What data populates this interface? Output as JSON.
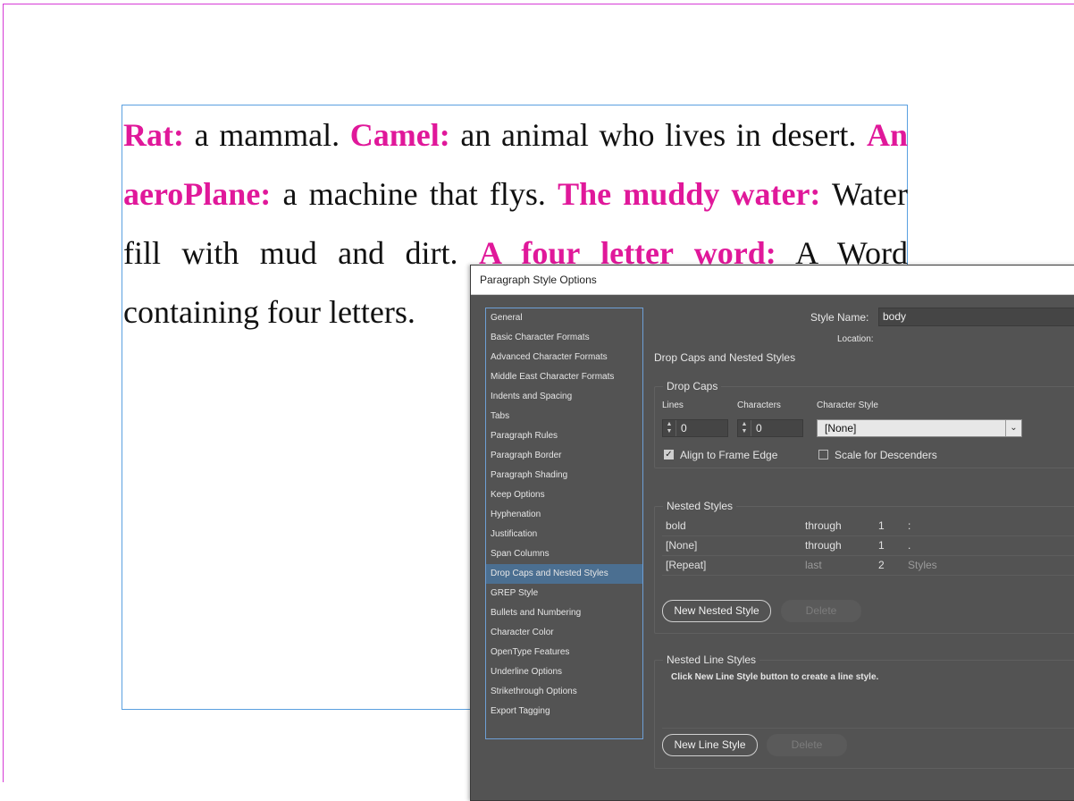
{
  "document": {
    "paragraph": [
      {
        "term": "Rat:",
        "def": " a mammal. "
      },
      {
        "term": "Camel:",
        "def": " an animal who lives in desert. "
      },
      {
        "term": "An aeroPlane:",
        "def": " a machine that flys. "
      },
      {
        "term": "The muddy water:",
        "def": " Water fill with mud and dirt. "
      },
      {
        "term": "A four letter word:",
        "def": " A Word containing four letters."
      }
    ]
  },
  "dialog": {
    "title": "Paragraph Style Options",
    "nav_items": [
      "General",
      "Basic Character Formats",
      "Advanced Character Formats",
      "Middle East Character Formats",
      "Indents and Spacing",
      "Tabs",
      "Paragraph Rules",
      "Paragraph Border",
      "Paragraph Shading",
      "Keep Options",
      "Hyphenation",
      "Justification",
      "Span Columns",
      "Drop Caps and Nested Styles",
      "GREP Style",
      "Bullets and Numbering",
      "Character Color",
      "OpenType Features",
      "Underline Options",
      "Strikethrough Options",
      "Export Tagging"
    ],
    "selected_nav": "Drop Caps and Nested Styles",
    "style_name_label": "Style Name:",
    "style_name_value": "body",
    "location_label": "Location:",
    "section_title": "Drop Caps and Nested Styles",
    "drop_caps": {
      "title": "Drop Caps",
      "lines_label": "Lines",
      "lines_value": "0",
      "characters_label": "Characters",
      "characters_value": "0",
      "char_style_label": "Character Style",
      "char_style_value": "[None]",
      "align_label": "Align to Frame Edge",
      "align_checked": true,
      "scale_label": "Scale for Descenders",
      "scale_checked": false
    },
    "nested_styles": {
      "title": "Nested Styles",
      "rows": [
        {
          "style": "bold",
          "mode": "through",
          "count": "1",
          "target": ":",
          "dim": false
        },
        {
          "style": "[None]",
          "mode": "through",
          "count": "1",
          "target": ".",
          "dim": false
        },
        {
          "style": "[Repeat]",
          "mode": "last",
          "count": "2",
          "target": "Styles",
          "dim": true
        }
      ],
      "new_button": "New Nested Style",
      "delete_button": "Delete"
    },
    "nested_line_styles": {
      "title": "Nested Line Styles",
      "hint": "Click New Line Style button to create a line style.",
      "new_button": "New Line Style",
      "delete_button": "Delete"
    }
  },
  "colors": {
    "term_color": "#e0189a",
    "guide_color": "#d63bd6",
    "frame_color": "#5aa0e0",
    "selected_nav_bg": "#4b6f91"
  }
}
